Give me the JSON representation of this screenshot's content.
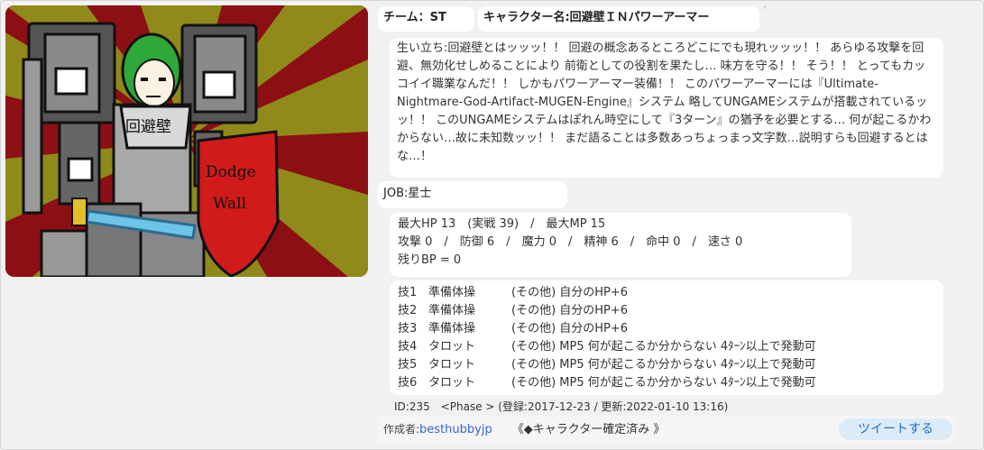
{
  "team": {
    "label": "チーム：ST"
  },
  "character": {
    "name_label": "キャラクター名:回避壁ＩＮパワーアーマー"
  },
  "art": {
    "chest_text": "回避壁",
    "shield_line1": "Dodge",
    "shield_line2": "Wall",
    "colors": {
      "ray_red": "#8c0f13",
      "ray_olive": "#8f8a1a",
      "hair": "#2fa83a",
      "shield": "#d11a1a",
      "sword": "#6cc4e8"
    }
  },
  "bio": {
    "text": "生い立ち:回避壁とはッッッ！！ 回避の概念あるところどこにでも現れッッッ！！ あらゆる攻撃を回避、無効化せしめることにより 前衛としての役割を果たし… 味方を守る！！ そう！！ とってもカッコイイ職業なんだ！！ しかもパワーアーマー装備！！ このパワーアーマーには『Ultimate-Nightmare-God-Artifact-MUGEN-Engine』システム 略してUNGAMEシステムが搭載されているッッ！！ このUNGAMEシステムはぽれん時空にして『3ターン』の猶予を必要とする… 何が起こるかわからない…故に未知数ッッ！！ まだ語ることは多数あっちょっまっ文字数…説明すらも回避するとはな…！"
  },
  "job": {
    "label": "JOB:星士"
  },
  "stats": {
    "line1": "最大HP 13　(実戦 39)　/　最大MP 15",
    "line2": "攻撃 0　/　防御 6　/　魔力 0　/　精神 6　/　命中 0　/　速さ 0",
    "line3": "残りBP = 0"
  },
  "skills": [
    {
      "no": "技1",
      "name": "準備体操",
      "desc": "(その他) 自分のHP+6"
    },
    {
      "no": "技2",
      "name": "準備体操",
      "desc": "(その他) 自分のHP+6"
    },
    {
      "no": "技3",
      "name": "準備体操",
      "desc": "(その他) 自分のHP+6"
    },
    {
      "no": "技4",
      "name": "タロット",
      "desc": "(その他) MP5 何が起こるか分からない 4ﾀｰﾝ以上で発動可"
    },
    {
      "no": "技5",
      "name": "タロット",
      "desc": "(その他) MP5 何が起こるか分からない 4ﾀｰﾝ以上で発動可"
    },
    {
      "no": "技6",
      "name": "タロット",
      "desc": "(その他) MP5 何が起こるか分からない 4ﾀｰﾝ以上で発動可"
    }
  ],
  "meta": {
    "text": "ID:235　<Phase > (登録:2017-12-23 / 更新:2022-01-10 13:16)"
  },
  "creator": {
    "label": "作成者:",
    "name": "besthubbyjp",
    "status": "《◆キャラクター確定済み 》"
  },
  "tweet": {
    "label": "ツイートする"
  }
}
